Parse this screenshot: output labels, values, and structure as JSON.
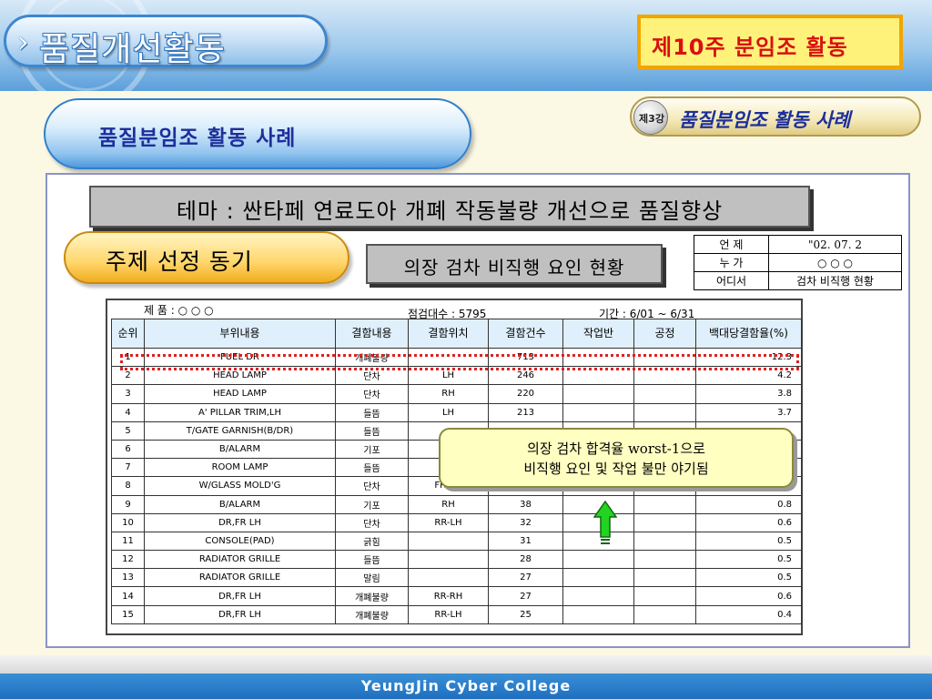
{
  "header": {
    "title": "품질개선활동",
    "chevron": "›",
    "week_label": "제10주 분임조 활동"
  },
  "sub_header": {
    "section_title": "품질분임조 활동 사례",
    "lesson_badge": "제3강",
    "lesson_title": "품질분임조 활동 사례"
  },
  "content": {
    "theme": "테마 : 싼타페 연료도아 개폐 작동불량 개선으로 품질향상",
    "motive_label": "주제 선정 동기",
    "status_label": "의장 검차 비직행 요인 현황",
    "info": [
      {
        "key": "언 제",
        "value": "\"02. 07. 2"
      },
      {
        "key": "누 가",
        "value": "○ ○ ○"
      },
      {
        "key": "어디서",
        "value": "검차 비직행 현황"
      }
    ]
  },
  "data_table": {
    "product": "제 품 : ○ ○ ○",
    "inspect_count": "점검대수 : 5795",
    "period": "기간 : 6/01 ~ 6/31",
    "headers": [
      "순위",
      "부위내용",
      "결함내용",
      "결함위치",
      "결함건수",
      "작업반",
      "공정",
      "백대당결함율(%)"
    ],
    "rows": [
      [
        "1",
        "FUEL DR",
        "개폐불량",
        "",
        "713",
        "",
        "",
        "12.3"
      ],
      [
        "2",
        "HEAD LAMP",
        "단차",
        "LH",
        "246",
        "",
        "",
        "4.2"
      ],
      [
        "3",
        "HEAD LAMP",
        "단차",
        "RH",
        "220",
        "",
        "",
        "3.8"
      ],
      [
        "4",
        "A' PILLAR TRIM,LH",
        "들뜸",
        "LH",
        "213",
        "",
        "",
        "3.7"
      ],
      [
        "5",
        "T/GATE GARNISH(B/DR)",
        "들뜸",
        "",
        "",
        "",
        "",
        ""
      ],
      [
        "6",
        "B/ALARM",
        "기포",
        "",
        "",
        "",
        "",
        ""
      ],
      [
        "7",
        "ROOM LAMP",
        "들뜸",
        "",
        "",
        "",
        "",
        ""
      ],
      [
        "8",
        "W/GLASS MOLD'G",
        "단차",
        "FR-RH",
        "42",
        "",
        "",
        "0.7"
      ],
      [
        "9",
        "B/ALARM",
        "기포",
        "RH",
        "38",
        "",
        "",
        "0.8"
      ],
      [
        "10",
        "DR,FR LH",
        "단차",
        "RR-LH",
        "32",
        "",
        "",
        "0.6"
      ],
      [
        "11",
        "CONSOLE(PAD)",
        "긁힘",
        "",
        "31",
        "",
        "",
        "0.5"
      ],
      [
        "12",
        "RADIATOR GRILLE",
        "들뜸",
        "",
        "28",
        "",
        "",
        "0.5"
      ],
      [
        "13",
        "RADIATOR GRILLE",
        "말림",
        "",
        "27",
        "",
        "",
        "0.5"
      ],
      [
        "14",
        "DR,FR LH",
        "개폐불량",
        "RR-RH",
        "27",
        "",
        "",
        "0.6"
      ],
      [
        "15",
        "DR,FR LH",
        "개폐불량",
        "RR-LH",
        "25",
        "",
        "",
        "0.4"
      ]
    ]
  },
  "callout": {
    "line1": "의장 검차 합격율 worst-1으로",
    "line2": "비직행 요인 및 작업 불만 야기됨"
  },
  "footer": {
    "text": "YeungJin Cyber College"
  }
}
